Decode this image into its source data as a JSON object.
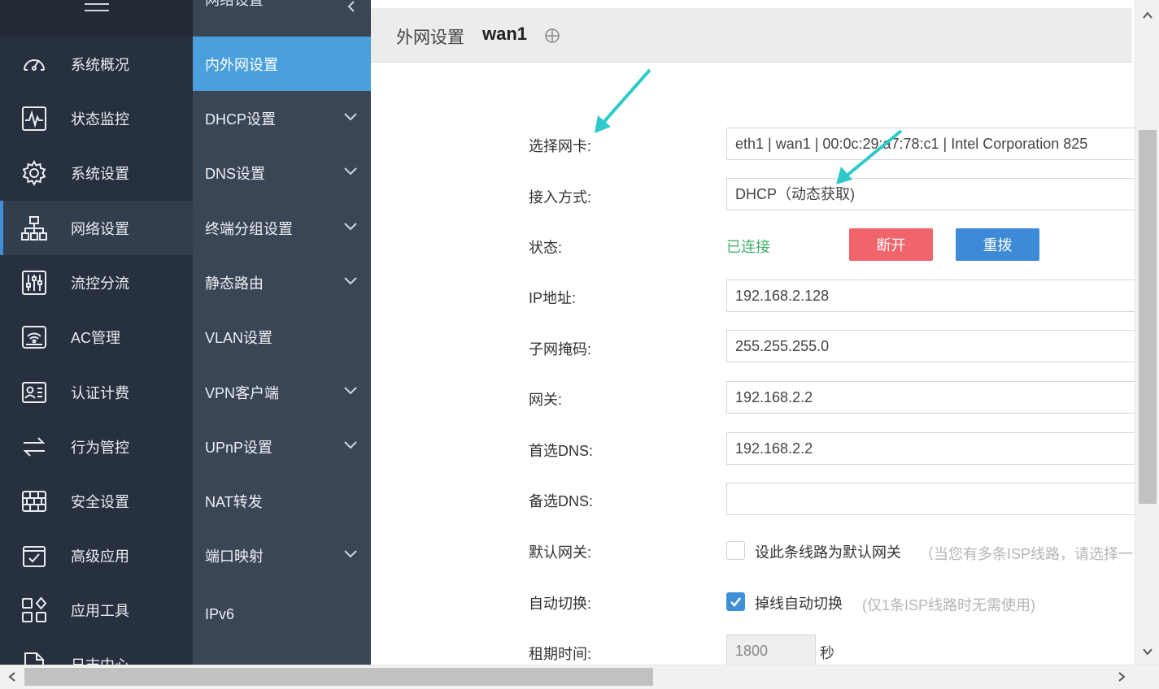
{
  "sidebar": {
    "items": [
      {
        "label": "系统概况",
        "icon": "dashboard-icon"
      },
      {
        "label": "状态监控",
        "icon": "pulse-monitor-icon"
      },
      {
        "label": "系统设置",
        "icon": "gear-icon"
      },
      {
        "label": "网络设置",
        "icon": "network-topology-icon",
        "active": true
      },
      {
        "label": "流控分流",
        "icon": "sliders-icon"
      },
      {
        "label": "AC管理",
        "icon": "wifi-router-icon"
      },
      {
        "label": "认证计费",
        "icon": "id-card-icon"
      },
      {
        "label": "行为管控",
        "icon": "swap-arrows-icon"
      },
      {
        "label": "安全设置",
        "icon": "firewall-icon"
      },
      {
        "label": "高级应用",
        "icon": "checklist-icon"
      },
      {
        "label": "应用工具",
        "icon": "apps-grid-icon"
      },
      {
        "label": "日志中心",
        "icon": "document-icon"
      }
    ]
  },
  "subnav": {
    "header": "网络设置",
    "items": [
      {
        "label": "内外网设置",
        "active": true,
        "chevron": false
      },
      {
        "label": "DHCP设置",
        "chevron": true
      },
      {
        "label": "DNS设置",
        "chevron": true
      },
      {
        "label": "终端分组设置",
        "chevron": true
      },
      {
        "label": "静态路由",
        "chevron": true
      },
      {
        "label": "VLAN设置",
        "chevron": false
      },
      {
        "label": "VPN客户端",
        "chevron": true
      },
      {
        "label": "UPnP设置",
        "chevron": true
      },
      {
        "label": "NAT转发",
        "chevron": false
      },
      {
        "label": "端口映射",
        "chevron": true
      },
      {
        "label": "IPv6",
        "chevron": false
      }
    ]
  },
  "panel": {
    "title": "外网设置",
    "interface": "wan1"
  },
  "form": {
    "nic_label": "选择网卡:",
    "nic_value": "eth1 | wan1 | 00:0c:29:a7:78:c1 | Intel Corporation 825",
    "access_label": "接入方式:",
    "access_value": "DHCP（动态获取)",
    "status_label": "状态:",
    "status_value": "已连接",
    "disconnect": "断开",
    "redial": "重拨",
    "ip_label": "IP地址:",
    "ip_value": "192.168.2.128",
    "mask_label": "子网掩码:",
    "mask_value": "255.255.255.0",
    "gateway_label": "网关:",
    "gateway_value": "192.168.2.2",
    "dns1_label": "首选DNS:",
    "dns1_value": "192.168.2.2",
    "dns2_label": "备选DNS:",
    "dns2_value": "",
    "default_gw_label": "默认网关:",
    "default_gw_check": "设此条线路为默认网关",
    "default_gw_hint": "（当您有多条ISP线路，请选择一",
    "default_gw_checked": false,
    "autoswitch_label": "自动切换:",
    "autoswitch_check": "掉线自动切换",
    "autoswitch_hint": "(仅1条ISP线路时无需使用)",
    "autoswitch_checked": true,
    "lease_label": "租期时间:",
    "lease_value": "1800",
    "lease_unit": "秒"
  },
  "colors": {
    "sidebar_bg": "#27303e",
    "subnav_bg": "#3a4556",
    "accent": "#4aa0dc",
    "connected": "#44b06a",
    "disconnect_btn": "#f0646b",
    "redial_btn": "#3d8ad6",
    "annotation_arrow": "#2ec9c9"
  }
}
